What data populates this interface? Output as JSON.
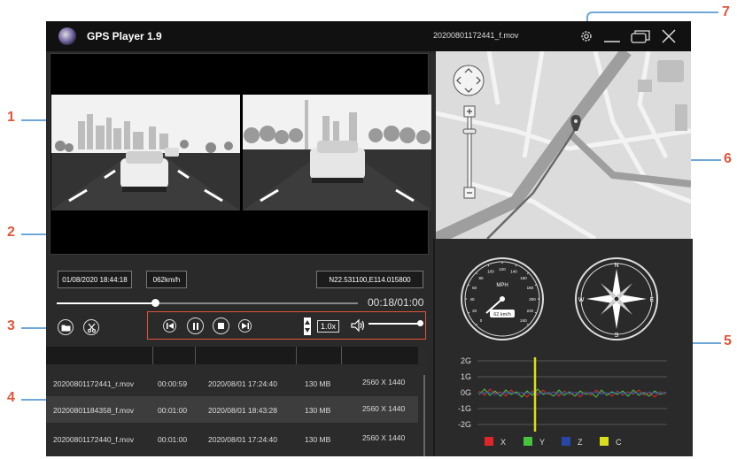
{
  "window": {
    "app_title": "GPS Player 1.9",
    "current_file": "20200801172441_f.mov"
  },
  "status": {
    "datetime": "01/08/2020 18:44:18",
    "speed": "062km/h",
    "coordinates": "N22.531100,E114.015800"
  },
  "playback": {
    "time": "00:18/01:00",
    "progress": 0.32,
    "speed_label": "1.0x",
    "volume": 1.0
  },
  "files": [
    {
      "name": "20200801172441_r.mov",
      "duration": "00:00:59",
      "date": "2020/08/01 17:24:40",
      "size": "130 MB",
      "resolution": "2560 X 1440"
    },
    {
      "name": "20200801184358_f.mov",
      "duration": "00:01:00",
      "date": "2020/08/01 18:43:28",
      "size": "130 MB",
      "resolution": "2560 X 1440"
    },
    {
      "name": "20200801172440_f.mov",
      "duration": "00:01:00",
      "date": "2020/08/01 17:24:40",
      "size": "130 MB",
      "resolution": "2560 X 1440"
    }
  ],
  "speedometer": {
    "unit": "MPH",
    "readout": "62 km/h",
    "ticks": [
      "0",
      "20",
      "40",
      "60",
      "80",
      "100",
      "120",
      "140",
      "160",
      "180",
      "200",
      "220",
      "240"
    ]
  },
  "compass": {
    "n": "N",
    "e": "E",
    "s": "S",
    "w": "W"
  },
  "gsensor": {
    "axis_labels": [
      "2G",
      "1G",
      "0G",
      "-1G",
      "-2G"
    ],
    "legend": [
      {
        "label": "X",
        "color": "#e0242b"
      },
      {
        "label": "Y",
        "color": "#46c43c"
      },
      {
        "label": "Z",
        "color": "#2846a8"
      },
      {
        "label": "C",
        "color": "#d8de1c"
      }
    ]
  },
  "callouts": [
    "1",
    "2",
    "3",
    "4",
    "5",
    "6",
    "7"
  ],
  "colors": {
    "accent": "#e0553a",
    "leader": "#6ea8d8"
  }
}
